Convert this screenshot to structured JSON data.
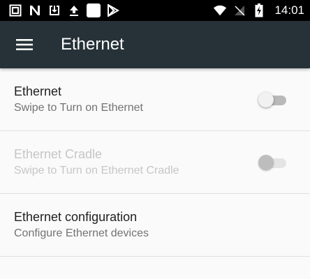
{
  "status_bar": {
    "time": "14:01",
    "left_icons": [
      "screenshot-icon",
      "n-app-icon",
      "download-icon",
      "upload-icon",
      "white-square-icon",
      "play-store-icon"
    ],
    "right_icons": [
      "wifi-icon",
      "no-signal-icon",
      "battery-charging-icon"
    ]
  },
  "app_bar": {
    "title": "Ethernet",
    "menu_icon": "hamburger-menu-icon",
    "background": "#263238"
  },
  "settings": [
    {
      "title": "Ethernet",
      "summary": "Swipe to Turn on Ethernet",
      "enabled": true,
      "switch_on": false
    },
    {
      "title": "Ethernet Cradle",
      "summary": "Swipe to Turn on Ethernet Cradle",
      "enabled": false,
      "switch_on": false
    },
    {
      "title": "Ethernet configuration",
      "summary": "Configure Ethernet devices",
      "enabled": true
    }
  ]
}
